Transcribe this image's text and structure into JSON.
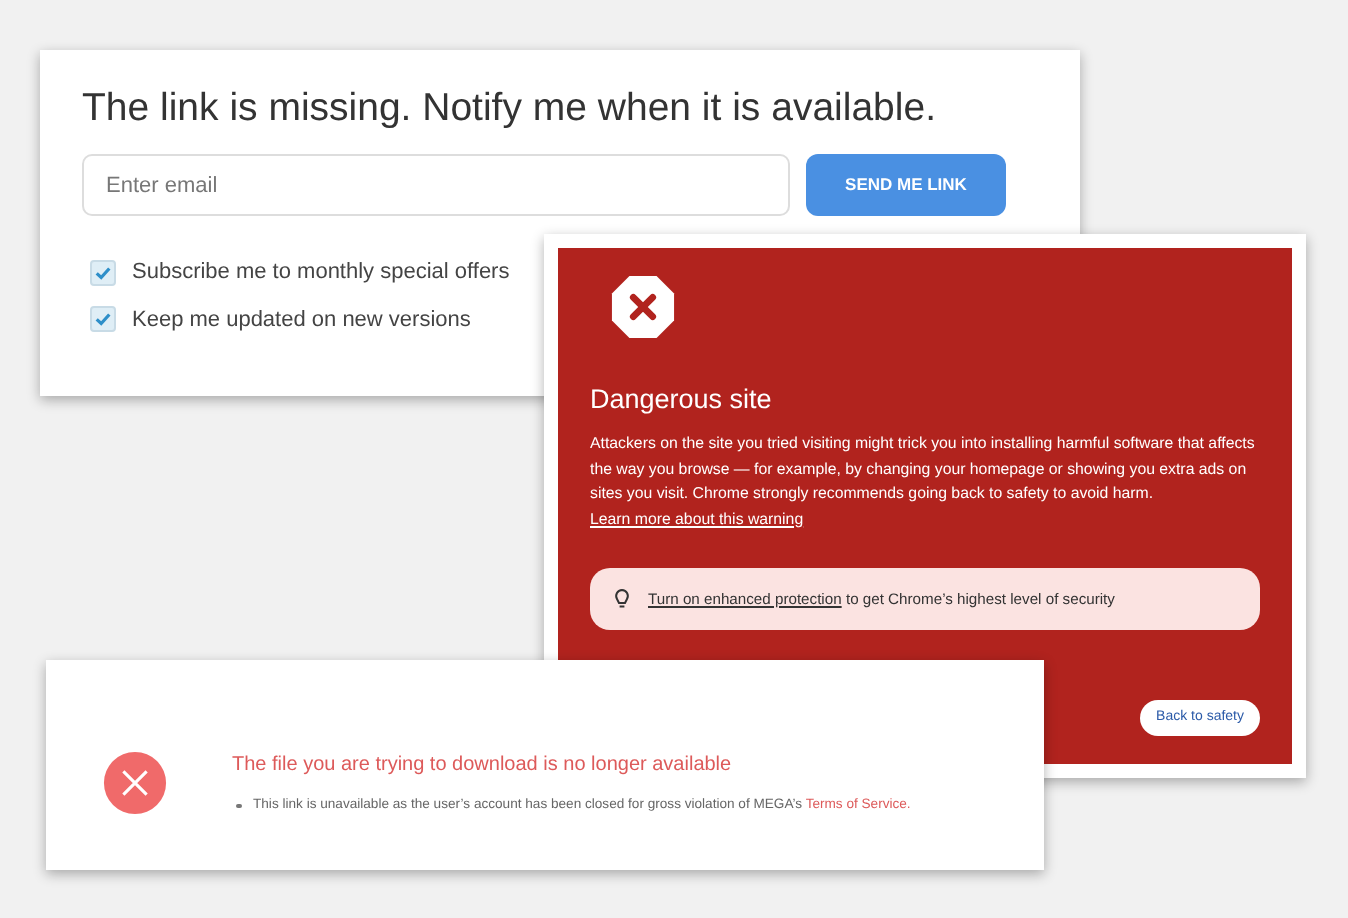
{
  "notify_card": {
    "title": "The link is missing. Notify me when it is available.",
    "email": {
      "placeholder": "Enter email"
    },
    "button": "SEND ME LINK",
    "options": [
      {
        "label": "Subscribe me to monthly special offers",
        "checked": true
      },
      {
        "label": "Keep me updated on new versions",
        "checked": true
      }
    ]
  },
  "warning_card": {
    "title": "Dangerous site",
    "body": "Attackers on the site you tried visiting might trick you into installing harmful software that affects the way you browse — for example, by changing your homepage or showing you extra ads on sites you visit. Chrome strongly recommends going back to safety to avoid harm.",
    "body_link": "Learn more about this warning",
    "banner_link": "Turn on enhanced protection",
    "banner_text": "to get Chrome’s highest level of security",
    "button": "Back to safety"
  },
  "download_card": {
    "title": "The file you are trying to download is no longer available",
    "message": "This link is unavailable as the user’s account has been closed for gross violation of MEGA’s",
    "message_link": "Terms of Service."
  }
}
